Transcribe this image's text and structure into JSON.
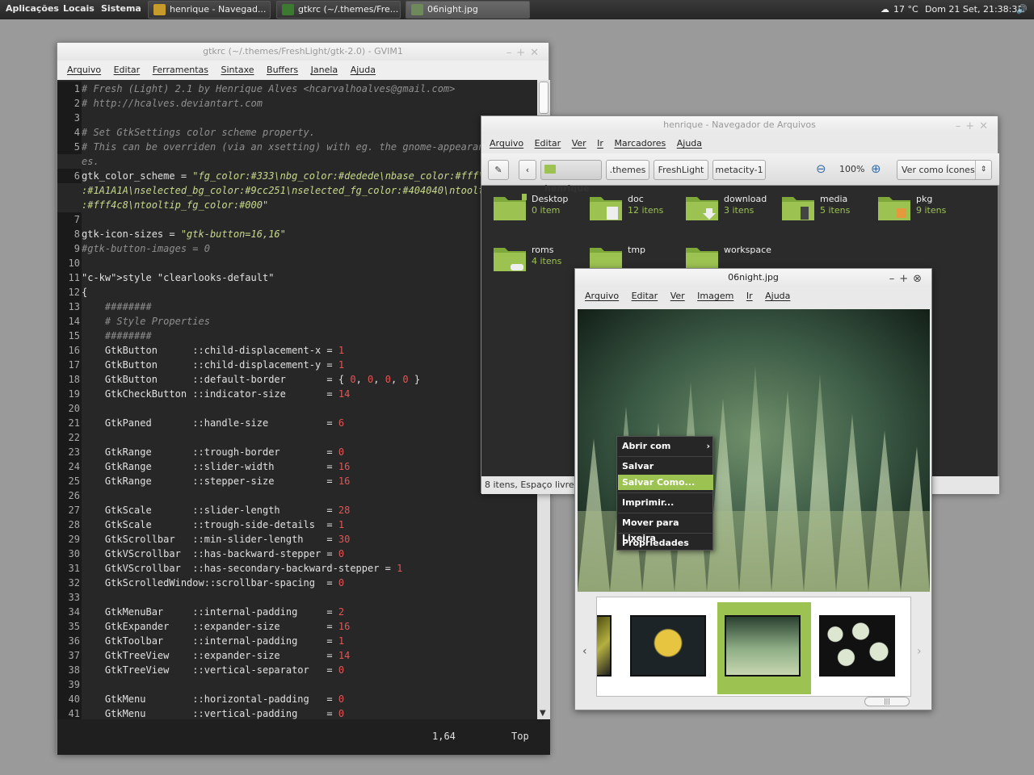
{
  "panel": {
    "menus": [
      "Aplicações",
      "Locais",
      "Sistema"
    ],
    "tasks": [
      "henrique - Navegad...",
      "gtkrc (~/.themes/Fre...",
      "06night.jpg"
    ],
    "weather": "17 °C",
    "clock": "Dom 21 Set, 21:38:31"
  },
  "gvim": {
    "title": "gtkrc (~/.themes/FreshLight/gtk-2.0) - GVIM1",
    "menu": [
      "Arquivo",
      "Editar",
      "Ferramentas",
      "Sintaxe",
      "Buffers",
      "Janela",
      "Ajuda"
    ],
    "status_pos": "1,64",
    "status_scroll": "Top",
    "lines": [
      {
        "n": "1",
        "t": "# Fresh (Light) 2.1 by Henrique Alves <hcarvalhoalves@gmail.com>",
        "k": "com"
      },
      {
        "n": "2",
        "t": "# http://hcalves.deviantart.com",
        "k": "com"
      },
      {
        "n": "3",
        "t": "",
        "k": ""
      },
      {
        "n": "4",
        "t": "# Set GtkSettings color scheme property.",
        "k": "com"
      },
      {
        "n": "5",
        "t": "# This can be overriden (via an xsetting) with eg. the gnome-appearance-properti",
        "k": "com"
      },
      {
        "n": "",
        "t": "es.",
        "k": "com"
      },
      {
        "n": "6",
        "t": "gtk_color_scheme = \"fg_color:#333\\nbg_color:#dedede\\nbase_color:#fff\\ntext_color",
        "k": "str"
      },
      {
        "n": "",
        "t": ":#1A1A1A\\nselected_bg_color:#9cc251\\nselected_fg_color:#404040\\ntooltip_bg_color",
        "k": "str"
      },
      {
        "n": "",
        "t": ":#fff4c8\\ntooltip_fg_color:#000\"",
        "k": "str"
      },
      {
        "n": "7",
        "t": "",
        "k": ""
      },
      {
        "n": "8",
        "t": "gtk-icon-sizes = \"gtk-button=16,16\"",
        "k": "str"
      },
      {
        "n": "9",
        "t": "#gtk-button-images = 0",
        "k": "com"
      },
      {
        "n": "10",
        "t": "",
        "k": ""
      },
      {
        "n": "11",
        "t": "style \"clearlooks-default\"",
        "k": "style"
      },
      {
        "n": "12",
        "t": "{",
        "k": ""
      },
      {
        "n": "13",
        "t": "    ########",
        "k": "com"
      },
      {
        "n": "14",
        "t": "    # Style Properties",
        "k": "com"
      },
      {
        "n": "15",
        "t": "    ########",
        "k": "com"
      },
      {
        "n": "16",
        "t": "    GtkButton      ::child-displacement-x = 1",
        "k": "num"
      },
      {
        "n": "17",
        "t": "    GtkButton      ::child-displacement-y = 1",
        "k": "num"
      },
      {
        "n": "18",
        "t": "    GtkButton      ::default-border       = { 0, 0, 0, 0 }",
        "k": "num"
      },
      {
        "n": "19",
        "t": "    GtkCheckButton ::indicator-size       = 14",
        "k": "num"
      },
      {
        "n": "20",
        "t": "",
        "k": ""
      },
      {
        "n": "21",
        "t": "    GtkPaned       ::handle-size          = 6",
        "k": "num"
      },
      {
        "n": "22",
        "t": "",
        "k": ""
      },
      {
        "n": "23",
        "t": "    GtkRange       ::trough-border        = 0",
        "k": "num"
      },
      {
        "n": "24",
        "t": "    GtkRange       ::slider-width         = 16",
        "k": "num"
      },
      {
        "n": "25",
        "t": "    GtkRange       ::stepper-size         = 16",
        "k": "num"
      },
      {
        "n": "26",
        "t": "",
        "k": ""
      },
      {
        "n": "27",
        "t": "    GtkScale       ::slider-length        = 28",
        "k": "num"
      },
      {
        "n": "28",
        "t": "    GtkScale       ::trough-side-details  = 1",
        "k": "num"
      },
      {
        "n": "29",
        "t": "    GtkScrollbar   ::min-slider-length    = 30",
        "k": "num"
      },
      {
        "n": "30",
        "t": "    GtkVScrollbar  ::has-backward-stepper = 0",
        "k": "num"
      },
      {
        "n": "31",
        "t": "    GtkVScrollbar  ::has-secondary-backward-stepper = 1",
        "k": "num"
      },
      {
        "n": "32",
        "t": "    GtkScrolledWindow::scrollbar-spacing  = 0",
        "k": "num"
      },
      {
        "n": "33",
        "t": "",
        "k": ""
      },
      {
        "n": "34",
        "t": "    GtkMenuBar     ::internal-padding     = 2",
        "k": "num"
      },
      {
        "n": "35",
        "t": "    GtkExpander    ::expander-size        = 16",
        "k": "num"
      },
      {
        "n": "36",
        "t": "    GtkToolbar     ::internal-padding     = 1",
        "k": "num"
      },
      {
        "n": "37",
        "t": "    GtkTreeView    ::expander-size        = 14",
        "k": "num"
      },
      {
        "n": "38",
        "t": "    GtkTreeView    ::vertical-separator   = 0",
        "k": "num"
      },
      {
        "n": "39",
        "t": "",
        "k": ""
      },
      {
        "n": "40",
        "t": "    GtkMenu        ::horizontal-padding   = 0",
        "k": "num"
      },
      {
        "n": "41",
        "t": "    GtkMenu        ::vertical-padding     = 0",
        "k": "num"
      }
    ]
  },
  "fm": {
    "title": "henrique - Navegador de Arquivos",
    "menu": [
      "Arquivo",
      "Editar",
      "Ver",
      "Ir",
      "Marcadores",
      "Ajuda"
    ],
    "path": [
      "henrique",
      ".themes",
      "FreshLight",
      "metacity-1"
    ],
    "zoom": "100%",
    "view_mode": "Ver como Ícones",
    "folders": [
      {
        "name": "Desktop",
        "count": "0 item"
      },
      {
        "name": "doc",
        "count": "12 itens"
      },
      {
        "name": "download",
        "count": "3 itens"
      },
      {
        "name": "media",
        "count": "5 itens"
      },
      {
        "name": "pkg",
        "count": "9 itens"
      },
      {
        "name": "roms",
        "count": "4 itens"
      },
      {
        "name": "tmp",
        "count": ""
      },
      {
        "name": "workspace",
        "count": ""
      }
    ],
    "status": "8 itens, Espaço livre: 2"
  },
  "eog": {
    "title": "06night.jpg",
    "menu": [
      "Arquivo",
      "Editar",
      "Ver",
      "Imagem",
      "Ir",
      "Ajuda"
    ],
    "context_menu": [
      "Abrir com",
      "Salvar",
      "Salvar Como...",
      "Imprimir...",
      "Mover para Lixeira",
      "Propriedades"
    ],
    "selected_item": "Salvar Como..."
  },
  "colors": {
    "accent": "#9cc251",
    "panel": "#2f2f2f",
    "editor_bg": "#272727"
  }
}
